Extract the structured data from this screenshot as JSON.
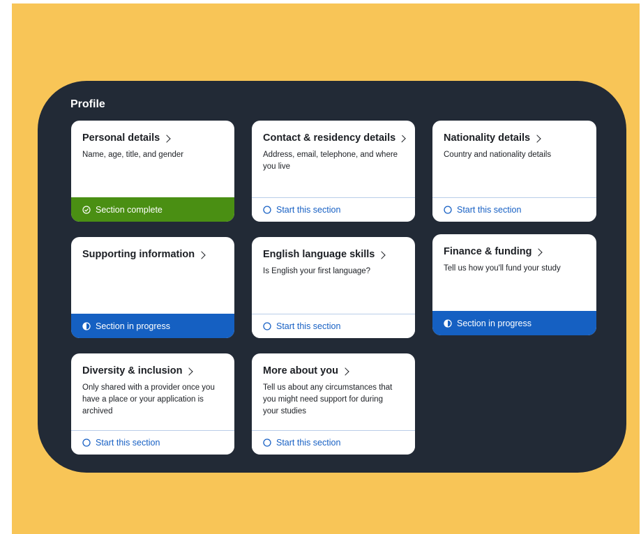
{
  "profile": {
    "title": "Profile",
    "cards": [
      {
        "title": "Personal details",
        "description": "Name, age, title, and gender",
        "status": "Section complete",
        "state": "complete"
      },
      {
        "title": "Contact & residency details",
        "description": "Address, email, telephone, and where you live",
        "status": "Start this section",
        "state": "not-started"
      },
      {
        "title": "Nationality details",
        "description": "Country and nationality details",
        "status": "Start this section",
        "state": "not-started"
      },
      {
        "title": "Supporting information",
        "description": "",
        "status": "Section in progress",
        "state": "in-progress"
      },
      {
        "title": "English language skills",
        "description": "Is English your first language?",
        "status": "Start this section",
        "state": "not-started"
      },
      {
        "title": "Finance & funding",
        "description": "Tell us how you'll fund your study",
        "status": "Section in progress",
        "state": "in-progress"
      },
      {
        "title": "Diversity & inclusion",
        "description": "Only shared with a provider once you have a place or your application is archived",
        "status": "Start this section",
        "state": "not-started"
      },
      {
        "title": "More about you",
        "description": "Tell us about any circumstances that you might need support for during your studies",
        "status": "Start this section",
        "state": "not-started"
      }
    ]
  },
  "colors": {
    "background": "#f8c557",
    "panel": "#222a36",
    "complete": "#4a8f13",
    "in_progress": "#1560c2",
    "link": "#1760c4"
  }
}
